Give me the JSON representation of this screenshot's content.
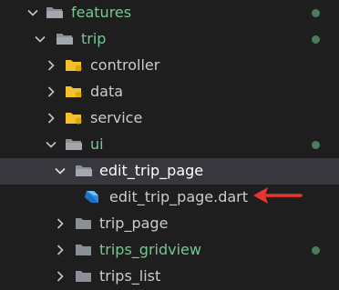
{
  "colors": {
    "background": "#1e1e1e",
    "selected_row": "#37373d",
    "text_default": "#cccccc",
    "text_selected": "#ffffff",
    "text_modified": "#73c991",
    "folder_gray": "#8a8f98",
    "folder_yellow": "#f2c22e",
    "arrow_red": "#e8352b"
  },
  "tree": {
    "items": [
      {
        "label": "features",
        "status": "modified",
        "icon": "folder-open-icon"
      },
      {
        "label": "trip",
        "status": "modified",
        "icon": "folder-open-icon"
      },
      {
        "label": "controller",
        "status": "default",
        "icon": "folder-yellow-icon"
      },
      {
        "label": "data",
        "status": "default",
        "icon": "folder-yellow-icon"
      },
      {
        "label": "service",
        "status": "default",
        "icon": "folder-yellow-icon"
      },
      {
        "label": "ui",
        "status": "modified",
        "icon": "folder-open-icon"
      },
      {
        "label": "edit_trip_page",
        "status": "selected",
        "icon": "folder-open-icon"
      },
      {
        "label": "edit_trip_page.dart",
        "status": "default",
        "icon": "dart-file-icon"
      },
      {
        "label": "trip_page",
        "status": "default",
        "icon": "folder-closed-icon"
      },
      {
        "label": "trips_gridview",
        "status": "modified",
        "icon": "folder-closed-icon"
      },
      {
        "label": "trips_list",
        "status": "default",
        "icon": "folder-closed-icon"
      }
    ]
  }
}
